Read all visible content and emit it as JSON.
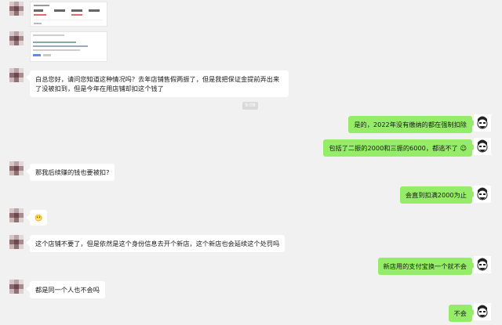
{
  "timestamp": "9:08",
  "messages": [
    {
      "text": "白总您好，请问您知道这种情况吗？去年店铺售假两振了，但是我把保证金提前弄出来了没被扣到，但是今年在用店铺却扣这个钱了"
    },
    {
      "text": "是的，2022年没有缴纳的都在强制扣除"
    },
    {
      "text": "包括了二振的2000和三振的6000，都逃不了",
      "emoji": "😉"
    },
    {
      "text": "那我后续赚的钱也要被扣?"
    },
    {
      "text": "会直到扣满2000为止"
    },
    {
      "emoji": "😬"
    },
    {
      "text": "这个店铺不要了，但是依然是这个身份信息去开个新店，这个新店也会延续这个处罚吗"
    },
    {
      "text": "新店用的支付宝换一个就不会"
    },
    {
      "text": "都是同一个人也不会吗"
    },
    {
      "text": "不会"
    }
  ],
  "colors": {
    "background": "#f1f1f1",
    "self_bubble": "#95ec69",
    "other_bubble": "#ffffff"
  }
}
